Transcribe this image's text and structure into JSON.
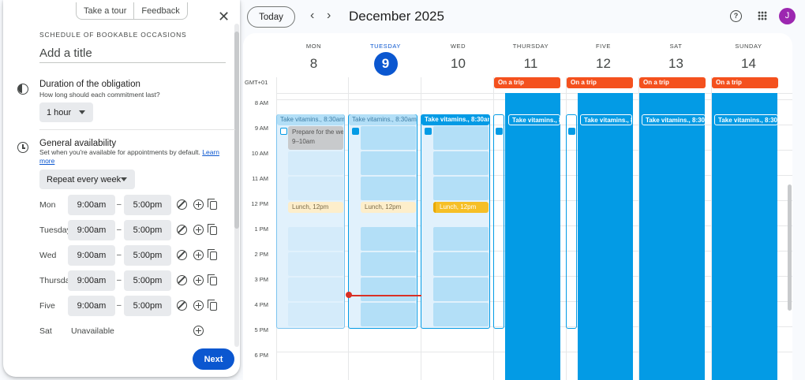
{
  "panel": {
    "take_tour": "Take a tour",
    "feedback": "Feedback",
    "heading": "SCHEDULE OF BOOKABLE OCCASIONS",
    "title_placeholder": "Add a title",
    "duration": {
      "title": "Duration of the obligation",
      "subtitle": "How long should each commitment last?",
      "value": "1 hour"
    },
    "availability": {
      "title": "General availability",
      "subtitle": "Set when you're available for appointments by default.",
      "learn_more": "Learn more",
      "repeat": "Repeat every week",
      "days": [
        {
          "label": "Mon",
          "start": "9:00am",
          "end": "5:00pm"
        },
        {
          "label": "Tuesday",
          "start": "9:00am",
          "end": "5:00pm"
        },
        {
          "label": "Wed",
          "start": "9:00am",
          "end": "5:00pm"
        },
        {
          "label": "Thursday",
          "start": "9:00am",
          "end": "5:00pm"
        },
        {
          "label": "Five",
          "start": "9:00am",
          "end": "5:00pm"
        }
      ],
      "sat": {
        "label": "Sat",
        "status": "Unavailable"
      },
      "dash": "–"
    },
    "next": "Next"
  },
  "header": {
    "today": "Today",
    "prev": "‹",
    "next": "›",
    "month": "December 2025",
    "help": "?",
    "avatar": "J"
  },
  "calendar": {
    "timezone": "GMT+01",
    "columns": [
      {
        "dow": "MON",
        "date": "8"
      },
      {
        "dow": "TUESDAY",
        "date": "9"
      },
      {
        "dow": "WED",
        "date": "10"
      },
      {
        "dow": "THURSDAY",
        "date": "11"
      },
      {
        "dow": "FIVE",
        "date": "12"
      },
      {
        "dow": "SAT",
        "date": "13"
      },
      {
        "dow": "SUNDAY",
        "date": "14"
      }
    ],
    "hours": [
      "8 AM",
      "9 AM",
      "10 AM",
      "11 AM",
      "12 PM",
      "1 PM",
      "2 PM",
      "3 PM",
      "4 PM",
      "5 PM",
      "6 PM"
    ],
    "trip_label": "On a trip",
    "vitamins_label": "Take vitamins., 8:30am",
    "prepare_title": "Prepare for the week",
    "prepare_time": "9–10am",
    "lunch_label": "Lunch, 12pm"
  },
  "colors": {
    "accent": "#0b57d0",
    "event_blue": "#039be5",
    "trip_orange": "#f4511e",
    "lunch_yellow": "#f6bf26",
    "now_red": "#d93025",
    "avatar": "#9c27b0"
  }
}
